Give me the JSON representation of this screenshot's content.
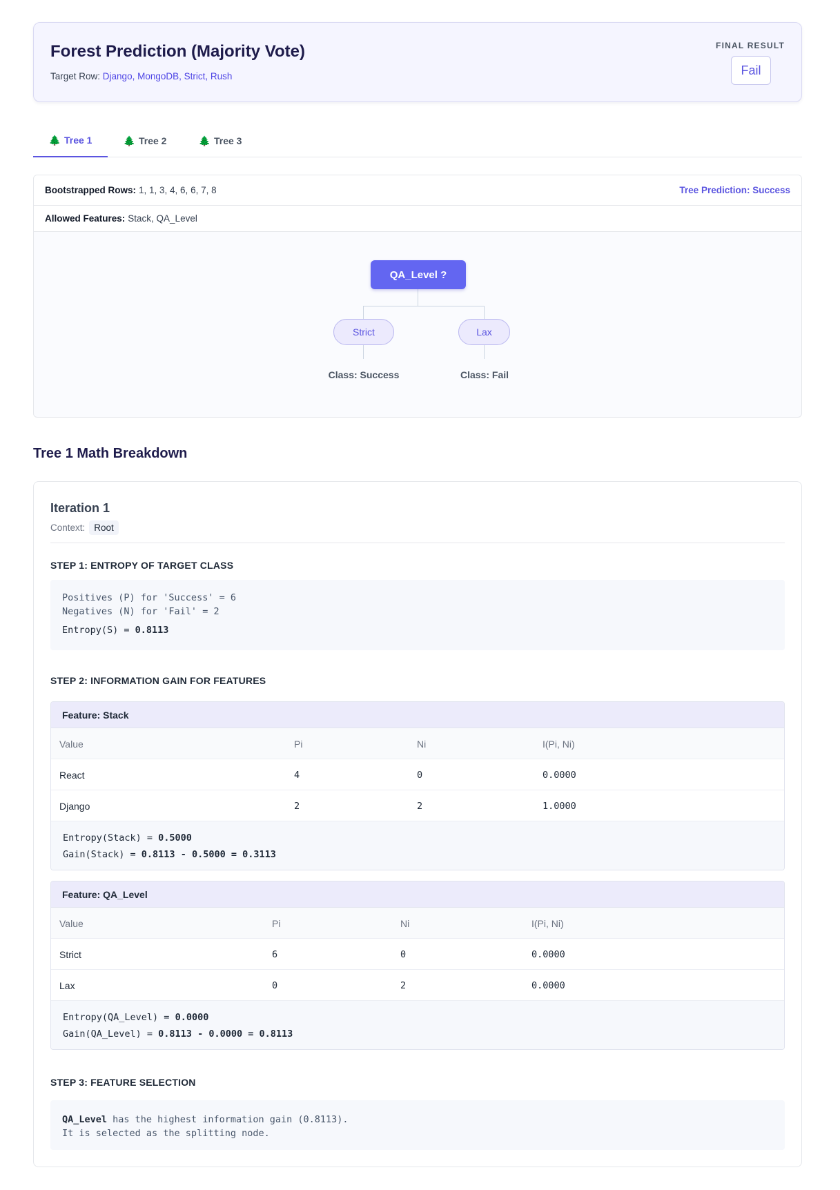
{
  "header": {
    "title": "Forest Prediction (Majority Vote)",
    "target_label": "Target Row:",
    "target_value": "Django, MongoDB, Strict, Rush",
    "final_label": "FINAL RESULT",
    "final_value": "Fail"
  },
  "tabs": [
    {
      "icon": "🌲",
      "label": "Tree 1",
      "active": true
    },
    {
      "icon": "🌲",
      "label": "Tree 2",
      "active": false
    },
    {
      "icon": "🌲",
      "label": "Tree 3",
      "active": false
    }
  ],
  "tree": {
    "bootstrapped_label": "Bootstrapped Rows:",
    "bootstrapped_value": "1, 1, 3, 4, 6, 6, 7, 8",
    "prediction": "Tree Prediction: Success",
    "allowed_label": "Allowed Features:",
    "allowed_value": "Stack, QA_Level",
    "root": "QA_Level ?",
    "branches": [
      {
        "label": "Strict",
        "leaf": "Class: Success"
      },
      {
        "label": "Lax",
        "leaf": "Class: Fail"
      }
    ]
  },
  "math": {
    "section_title": "Tree 1 Math Breakdown",
    "iteration": "Iteration 1",
    "context_label": "Context:",
    "context_value": "Root",
    "step1_title": "STEP 1: ENTROPY OF TARGET CLASS",
    "step1_lines": [
      "Positives (P) for 'Success' = 6",
      "Negatives (N) for 'Fail' = 2"
    ],
    "step1_entropy_label": "Entropy(S) = ",
    "step1_entropy_value": "0.8113",
    "step2_title": "STEP 2: INFORMATION GAIN FOR FEATURES",
    "features": [
      {
        "title": "Feature: Stack",
        "headers": [
          "Value",
          "Pi",
          "Ni",
          "I(Pi, Ni)"
        ],
        "rows": [
          [
            "React",
            "4",
            "0",
            "0.0000"
          ],
          [
            "Django",
            "2",
            "2",
            "1.0000"
          ]
        ],
        "entropy_label": "Entropy(Stack) = ",
        "entropy_value": "0.5000",
        "gain_label": "Gain(Stack) = ",
        "gain_value": "0.8113 - 0.5000 = 0.3113"
      },
      {
        "title": "Feature: QA_Level",
        "headers": [
          "Value",
          "Pi",
          "Ni",
          "I(Pi, Ni)"
        ],
        "rows": [
          [
            "Strict",
            "6",
            "0",
            "0.0000"
          ],
          [
            "Lax",
            "0",
            "2",
            "0.0000"
          ]
        ],
        "entropy_label": "Entropy(QA_Level) = ",
        "entropy_value": "0.0000",
        "gain_label": "Gain(QA_Level) = ",
        "gain_value": "0.8113 - 0.0000 = 0.8113"
      }
    ],
    "step3_title": "STEP 3: FEATURE SELECTION",
    "step3_feature": "QA_Level",
    "step3_line1_rest": " has the highest information gain (0.8113).",
    "step3_line2": "It is selected as the splitting node."
  }
}
